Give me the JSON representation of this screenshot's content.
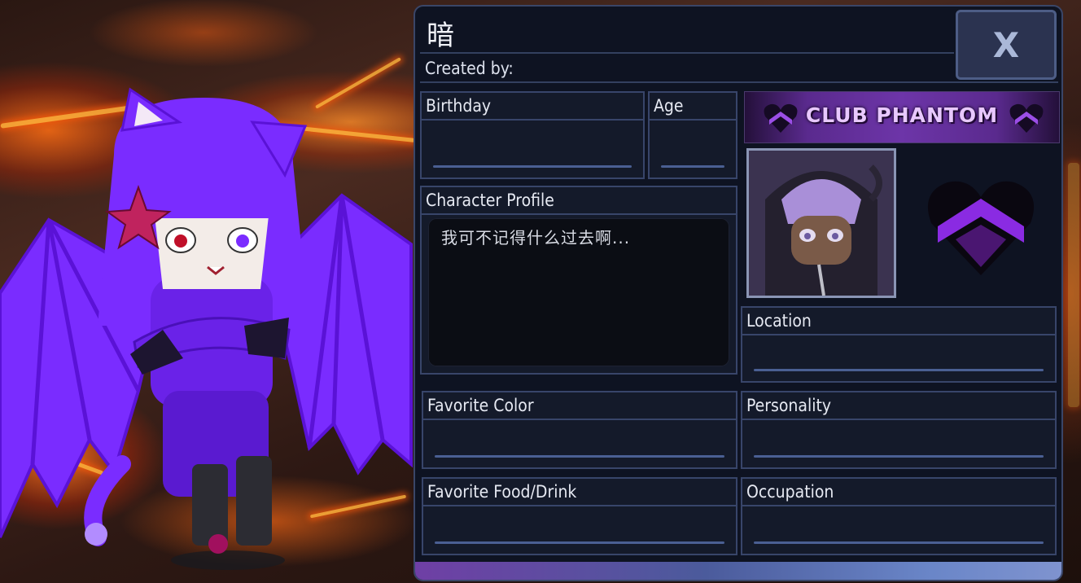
{
  "panel": {
    "title": "暗",
    "created_by_label": "Created by:",
    "close_label": "X"
  },
  "fields": {
    "birthday": {
      "label": "Birthday",
      "value": ""
    },
    "age": {
      "label": "Age",
      "value": ""
    },
    "character_profile": {
      "label": "Character Profile",
      "value": "我可不记得什么过去啊..."
    },
    "location": {
      "label": "Location",
      "value": ""
    },
    "favorite_color": {
      "label": "Favorite Color",
      "value": ""
    },
    "personality": {
      "label": "Personality",
      "value": ""
    },
    "favorite_food": {
      "label": "Favorite Food/Drink",
      "value": ""
    },
    "occupation": {
      "label": "Occupation",
      "value": ""
    }
  },
  "banner": {
    "text": "CLUB PHANTOM",
    "icon": "heart-m-icon"
  },
  "heart_emblem": {
    "icon": "heart-m-icon"
  },
  "colors": {
    "panel_bg": "#0e1322",
    "panel_border": "#3a4668",
    "accent_purple": "#7a2cff",
    "field_underline": "#4a5f93"
  }
}
